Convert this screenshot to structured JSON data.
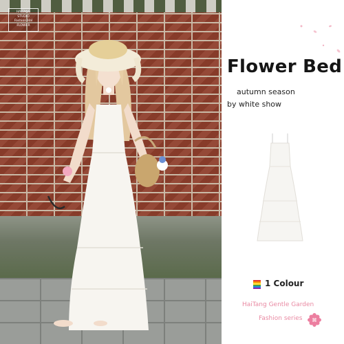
{
  "logo": {
    "line1": "HAITANG",
    "line2": "STUDIO",
    "line3": "Fashion Hal",
    "line4": "FLOWER"
  },
  "product": {
    "title": "Flower Bed",
    "subtitle1": "autumn season",
    "subtitle2": "by white show",
    "colour_count": "1 Colour",
    "series_line1": "HaiTang Gentle Garden",
    "series_line2": "Fashion series"
  },
  "colors": {
    "accent_pink": "#e98aa3",
    "title_text": "#151515",
    "dress": "#f7f5f0",
    "brick": "#8f3f2c"
  },
  "icons": {
    "swatch": "rainbow-swatch-icon",
    "flower": "pink-flower-icon",
    "petals": "petal-decoration-icon"
  }
}
